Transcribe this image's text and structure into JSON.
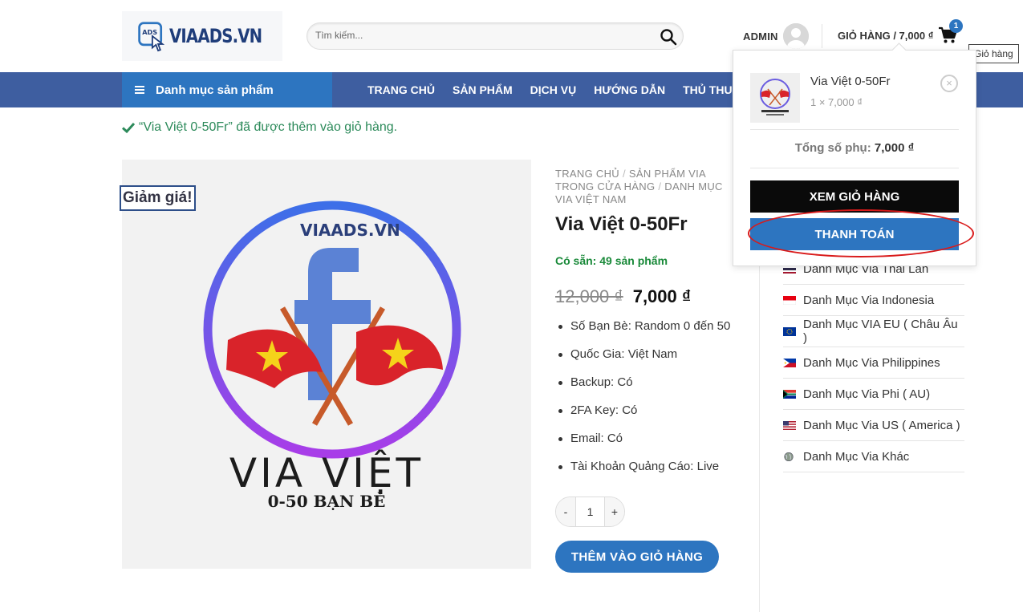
{
  "header": {
    "logo_text": "VIAADS.VN",
    "search": {
      "placeholder": "Tìm kiếm..."
    },
    "admin_label": "ADMIN",
    "cart_label": "GIỎ HÀNG / 7,000 ₫",
    "cart_count": "1",
    "cart_tooltip": "Giỏ hàng"
  },
  "nav": {
    "category_menu": "Danh mục sản phẩm",
    "items": [
      "TRANG CHỦ",
      "SẢN PHẨM",
      "DỊCH VỤ",
      "HƯỚNG DẪN",
      "THỦ THUẬT"
    ]
  },
  "notice": "“Via Việt 0-50Fr” đã được thêm vào giỏ hàng.",
  "product": {
    "sale_badge": "Giảm giá!",
    "image_logo": "VIAADS.VN",
    "image_title": "VIA VIỆT",
    "image_subtitle": "0-50 BẠN BÈ",
    "breadcrumb": [
      "TRANG CHỦ",
      "SẢN PHẨM VIA TRONG CỬA HÀNG",
      "DANH MỤC VIA VIỆT NAM"
    ],
    "title": "Via Việt 0-50Fr",
    "stock": "Có sẵn: 49 sản phẩm",
    "old_price": "12,000 ₫",
    "new_price": "7,000 ₫",
    "attributes": [
      "Số Bạn Bè: Random 0 đến 50",
      "Quốc Gia: Việt Nam",
      "Backup: Có",
      "2FA Key: Có",
      "Email: Có",
      "Tài Khoản Quảng Cáo: Live"
    ],
    "qty_minus": "-",
    "qty_value": "1",
    "qty_plus": "+",
    "add_to_cart": "THÊM VÀO GIỎ HÀNG"
  },
  "sidebar": {
    "categories": [
      {
        "label": "Danh Mục Via Thái Lan",
        "flag": "thailand"
      },
      {
        "label": "Danh Mục Via Indonesia",
        "flag": "indonesia"
      },
      {
        "label": "Danh Mục VIA EU ( Châu Âu )",
        "flag": "eu"
      },
      {
        "label": "Danh Mục Via Philippines",
        "flag": "philippines"
      },
      {
        "label": "Danh Mục Via Phi ( AU)",
        "flag": "south-africa"
      },
      {
        "label": "Danh Mục Via US ( America )",
        "flag": "usa"
      },
      {
        "label": "Danh Mục Via Khác",
        "flag": "globe"
      }
    ]
  },
  "cart_dropdown": {
    "item_name": "Via Việt 0-50Fr",
    "item_qty": "1 × 7,000 ₫",
    "remove": "×",
    "subtotal_label": "Tổng số phụ:",
    "subtotal_value": "7,000 ₫",
    "view_cart": "XEM GIỎ HÀNG",
    "checkout": "THANH TOÁN"
  },
  "colors": {
    "nav_bg": "#3e5ea0",
    "accent": "#2d75c0",
    "highlight": "#d91a1a",
    "stock_green": "#1a8a3a"
  }
}
